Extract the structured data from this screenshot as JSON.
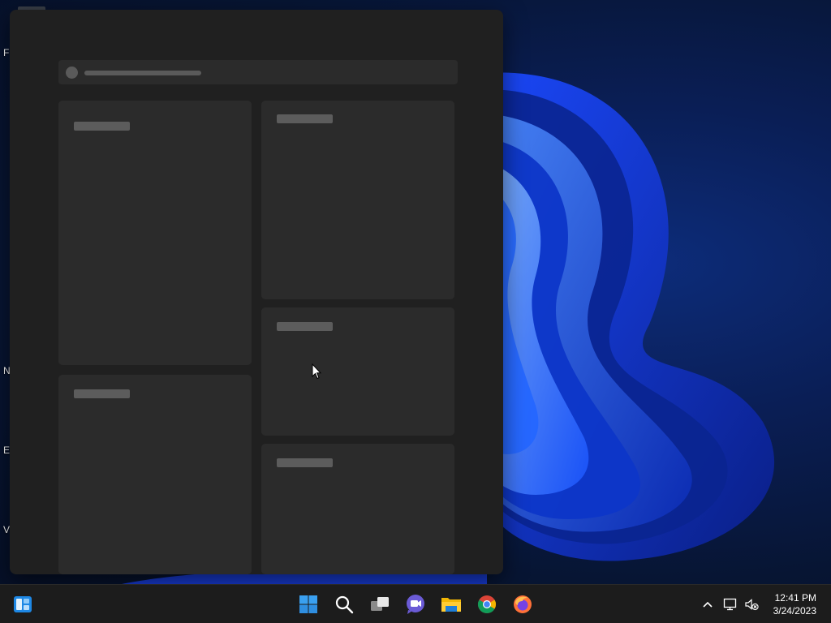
{
  "desktop": {
    "icon_letters": [
      "F",
      "N",
      "Er",
      "V"
    ]
  },
  "widgets": {
    "search": {
      "placeholder_icon": "search-placeholder-dot"
    },
    "cards": [
      {
        "name": "widget-card-left-top"
      },
      {
        "name": "widget-card-left-bottom"
      },
      {
        "name": "widget-card-right-top"
      },
      {
        "name": "widget-card-right-middle"
      },
      {
        "name": "widget-card-right-bottom"
      }
    ]
  },
  "taskbar": {
    "pinned": [
      {
        "name": "widgets-icon"
      },
      {
        "name": "start-icon"
      },
      {
        "name": "search-icon"
      },
      {
        "name": "task-view-icon"
      },
      {
        "name": "chat-icon"
      },
      {
        "name": "file-explorer-icon"
      },
      {
        "name": "chrome-icon"
      },
      {
        "name": "firefox-icon"
      }
    ],
    "tray": {
      "overflow_icon": "chevron-up-icon",
      "network_icon": "network-icon",
      "volume_icon": "volume-muted-icon"
    },
    "clock": {
      "time": "12:41 PM",
      "date": "3/24/2023"
    }
  },
  "colors": {
    "panel_bg": "#202020",
    "card_bg": "#2b2b2b",
    "skeleton": "#5c5c5c",
    "taskbar_bg": "#1c1c1c",
    "accent_blue": "#0067c0",
    "start_blue": "#3aa0f0"
  }
}
